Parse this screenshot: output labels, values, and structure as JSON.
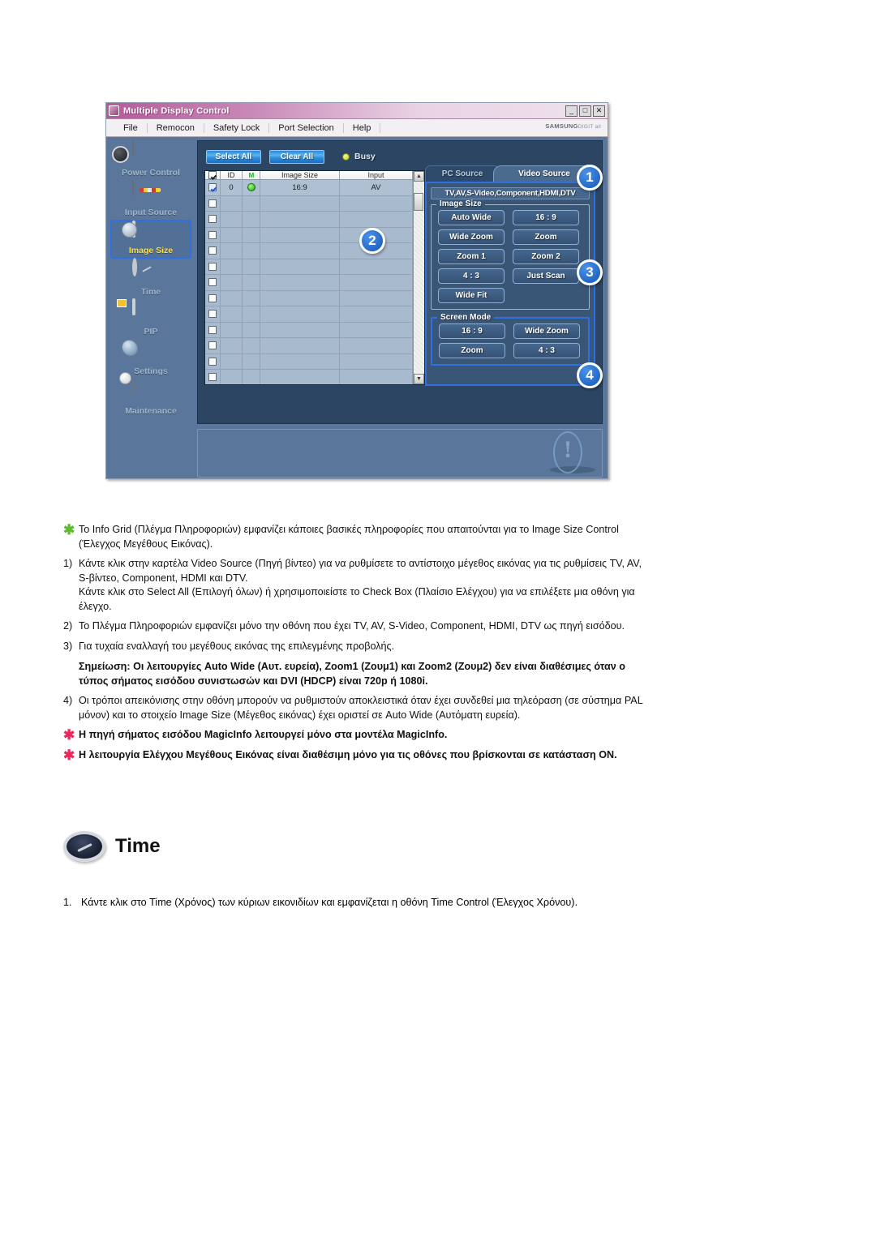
{
  "app": {
    "titlebar": {
      "title": "Multiple Display Control",
      "icon": "app-icon",
      "minimize": "_",
      "maximize": "□",
      "close": "✕"
    },
    "menu": [
      "File",
      "Remocon",
      "Safety Lock",
      "Port Selection",
      "Help"
    ],
    "brand": "SAMSUNG",
    "brand_sub": "DIGIT all",
    "sidebar": [
      {
        "label": "Power Control",
        "icon": "power-control-icon",
        "selected": false
      },
      {
        "label": "Input Source",
        "icon": "input-source-icon",
        "selected": false
      },
      {
        "label": "Image Size",
        "icon": "image-size-icon",
        "selected": true
      },
      {
        "label": "Time",
        "icon": "time-clock-icon",
        "selected": false
      },
      {
        "label": "PIP",
        "icon": "pip-icon",
        "selected": false
      },
      {
        "label": "Settings",
        "icon": "settings-icon",
        "selected": false
      },
      {
        "label": "Maintenance",
        "icon": "maintenance-icon",
        "selected": false
      }
    ],
    "toolbar": {
      "select_all": "Select All",
      "clear_all": "Clear All",
      "busy_label": "Busy",
      "busy_led_color": "#d8dd2e"
    },
    "grid": {
      "columns": [
        "",
        "ID",
        "M",
        "Image Size",
        "Input"
      ],
      "rows": [
        {
          "checked": true,
          "id": "0",
          "power": "on",
          "image_size": "16:9",
          "input": "AV"
        },
        {
          "checked": false,
          "id": "",
          "power": "",
          "image_size": "",
          "input": ""
        },
        {
          "checked": false,
          "id": "",
          "power": "",
          "image_size": "",
          "input": ""
        },
        {
          "checked": false,
          "id": "",
          "power": "",
          "image_size": "",
          "input": ""
        },
        {
          "checked": false,
          "id": "",
          "power": "",
          "image_size": "",
          "input": ""
        },
        {
          "checked": false,
          "id": "",
          "power": "",
          "image_size": "",
          "input": ""
        },
        {
          "checked": false,
          "id": "",
          "power": "",
          "image_size": "",
          "input": ""
        },
        {
          "checked": false,
          "id": "",
          "power": "",
          "image_size": "",
          "input": ""
        },
        {
          "checked": false,
          "id": "",
          "power": "",
          "image_size": "",
          "input": ""
        },
        {
          "checked": false,
          "id": "",
          "power": "",
          "image_size": "",
          "input": ""
        },
        {
          "checked": false,
          "id": "",
          "power": "",
          "image_size": "",
          "input": ""
        },
        {
          "checked": false,
          "id": "",
          "power": "",
          "image_size": "",
          "input": ""
        },
        {
          "checked": false,
          "id": "",
          "power": "",
          "image_size": "",
          "input": ""
        }
      ]
    },
    "source": {
      "tab_pc": "PC Source",
      "tab_video": "Video Source",
      "active_tab": "Video Source",
      "signal_types": "TV,AV,S-Video,Component,HDMI,DTV",
      "image_size": {
        "legend": "Image Size",
        "buttons": [
          "Auto Wide",
          "16 : 9",
          "Wide Zoom",
          "Zoom",
          "Zoom 1",
          "Zoom 2",
          "4 : 3",
          "Just Scan",
          "Wide Fit"
        ]
      },
      "screen_mode": {
        "legend": "Screen Mode",
        "buttons": [
          "16 : 9",
          "Wide Zoom",
          "Zoom",
          "4 : 3"
        ]
      }
    },
    "callouts": [
      "1",
      "2",
      "3",
      "4"
    ],
    "accent_color": "#2f6fe0",
    "panel_color": "#2c4563",
    "window_color": "#5a779b"
  },
  "doc": {
    "intro": "Το Info Grid (Πλέγμα Πληροφοριών) εμφανίζει κάποιες βασικές πληροφορίες που απαιτούνται για το Image Size Control (Έλεγχος Μεγέθους Εικόνας).",
    "items": [
      {
        "num": "1)",
        "text": "Κάντε κλικ στην καρτέλα Video Source (Πηγή βίντεο) για να ρυθμίσετε το αντίστοιχο μέγεθος εικόνας για τις ρυθμίσεις TV, AV, S-βίντεο, Component, HDMI και DTV.",
        "text2": "Κάντε κλικ στο Select All (Επιλογή όλων) ή χρησιμοποιείστε το Check Box (Πλαίσιο Ελέγχου) για να επιλέξετε μια οθόνη για έλεγχο."
      },
      {
        "num": "2)",
        "text": "Το Πλέγμα Πληροφοριών εμφανίζει μόνο την οθόνη που έχει TV, AV, S-Video, Component, HDMI, DTV ως πηγή εισόδου.",
        "text2": ""
      },
      {
        "num": "3)",
        "text": "Για τυχαία εναλλαγή του μεγέθους εικόνας της επιλεγμένης προβολής.",
        "text2": ""
      }
    ],
    "note_bold": "Σημείωση: Οι λειτουργίες Auto Wide (Αυτ. ευρεία), Zoom1 (Ζουμ1) και Zoom2 (Ζουμ2) δεν είναι διαθέσιμες όταν ο τύπος σήματος εισόδου συνιστωσών και DVI (HDCP) είναι 720p ή 1080i.",
    "item4": {
      "num": "4)",
      "text": "Οι τρόποι απεικόνισης στην οθόνη μπορούν να ρυθμιστούν αποκλειστικά όταν έχει συνδεθεί μια τηλεόραση (σε σύστημα PAL μόνον) και το στοιχείο Image Size (Μέγεθος εικόνας) έχει οριστεί σε Auto Wide (Αυτόματη ευρεία)."
    },
    "star_note_1": "Η πηγή σήματος εισόδου MagicInfo λειτουργεί μόνο στα μοντέλα MagicInfo.",
    "star_note_2": "Η λειτουργία Ελέγχου Μεγέθους Εικόνας είναι διαθέσιμη μόνο για τις οθόνες που βρίσκονται σε κατάσταση ON."
  },
  "time_section": {
    "title": "Time",
    "icon": "time-clock-icon",
    "step_num": "1.",
    "step_text": "Κάντε κλικ στο Time (Χρόνος) των κύριων εικονιδίων και εμφανίζεται η οθόνη Time Control (Έλεγχος Χρόνου)."
  }
}
